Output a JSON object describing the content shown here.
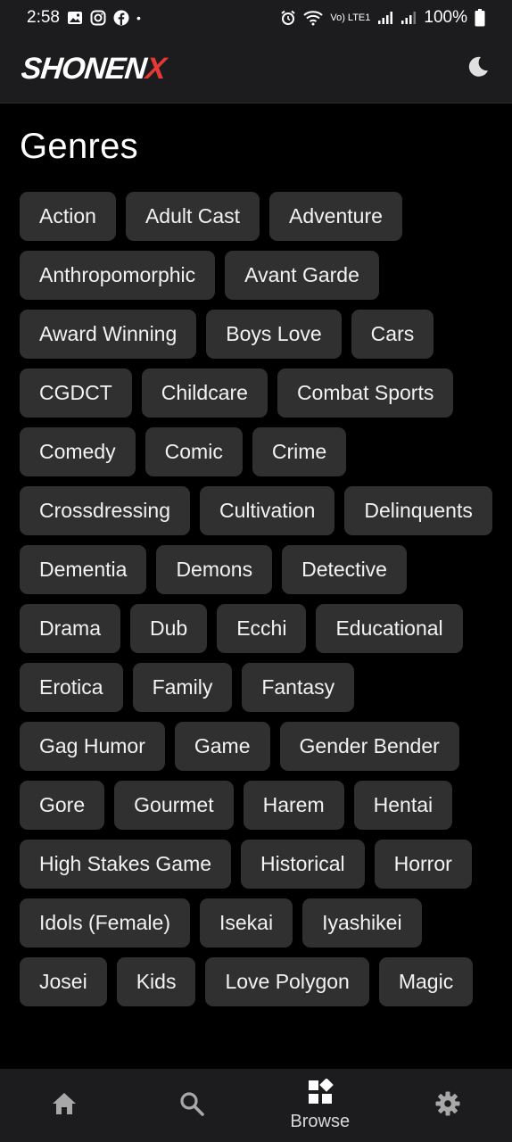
{
  "status_bar": {
    "time": "2:58",
    "battery_percent": "100%",
    "signal_label": "Vo) LTE1"
  },
  "header": {
    "logo_main": "SHONEN",
    "logo_accent": "X",
    "accent_color": "#e53935"
  },
  "page": {
    "title": "Genres"
  },
  "genres": [
    "Action",
    "Adult Cast",
    "Adventure",
    "Anthropomorphic",
    "Avant Garde",
    "Award Winning",
    "Boys Love",
    "Cars",
    "CGDCT",
    "Childcare",
    "Combat Sports",
    "Comedy",
    "Comic",
    "Crime",
    "Crossdressing",
    "Cultivation",
    "Delinquents",
    "Dementia",
    "Demons",
    "Detective",
    "Drama",
    "Dub",
    "Ecchi",
    "Educational",
    "Erotica",
    "Family",
    "Fantasy",
    "Gag Humor",
    "Game",
    "Gender Bender",
    "Gore",
    "Gourmet",
    "Harem",
    "Hentai",
    "High Stakes Game",
    "Historical",
    "Horror",
    "Idols (Female)",
    "Isekai",
    "Iyashikei",
    "Josei",
    "Kids",
    "Love Polygon",
    "Magic"
  ],
  "bottom_nav": {
    "home_icon": "home-icon",
    "search_icon": "search-icon",
    "browse_label": "Browse",
    "settings_icon": "gear-icon",
    "active": "browse"
  }
}
